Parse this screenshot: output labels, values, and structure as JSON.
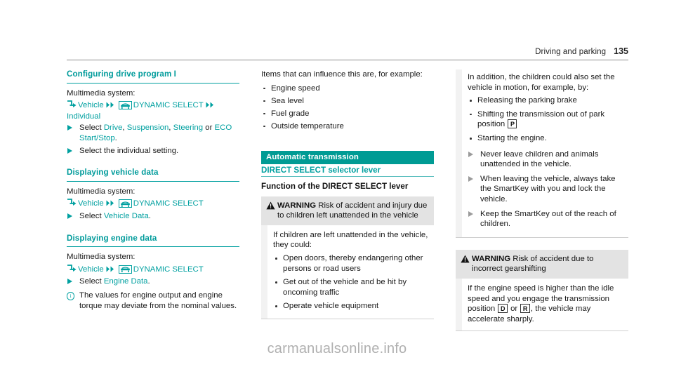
{
  "header": {
    "section_title": "Driving and parking",
    "page_number": "135"
  },
  "watermark": "carmanualsonline.info",
  "colors": {
    "teal": "#009b9b",
    "teal_bar": "#009b94",
    "warning_header_bg": "#e3e3e3",
    "text": "#1a1a1a"
  },
  "icons": {
    "hook_arrow": "hook-arrow-icon",
    "double_arrow": "double-arrow-icon",
    "vehicle_glyph": "vehicle-icon",
    "warning_triangle": "warning-triangle-icon",
    "info_circle": "info-circle-icon",
    "action_triangle": "action-arrow-icon"
  },
  "column1": {
    "sections": [
      {
        "heading": "Configuring drive program I",
        "intro": "Multimedia system:",
        "path": {
          "item1": "Vehicle",
          "item2": "DYNAMIC SELECT",
          "item3": "Individual"
        },
        "actions": [
          {
            "text_before": "Select ",
            "link1": "Drive",
            "sep1": ", ",
            "link2": "Suspension",
            "sep2": ", ",
            "link3": "Steering",
            "sep3": " or ",
            "link4": "ECO Start/Stop",
            "text_after": "."
          },
          {
            "plain": "Select the individual setting."
          }
        ]
      },
      {
        "heading": "Displaying vehicle data",
        "intro": "Multimedia system:",
        "path": {
          "item1": "Vehicle",
          "item2": "DYNAMIC SELECT"
        },
        "actions": [
          {
            "text_before": "Select ",
            "link1": "Vehicle Data",
            "text_after": "."
          }
        ]
      },
      {
        "heading": "Displaying engine data",
        "intro": "Multimedia system:",
        "path": {
          "item1": "Vehicle",
          "item2": "DYNAMIC SELECT"
        },
        "actions": [
          {
            "text_before": "Select ",
            "link1": "Engine Data",
            "text_after": "."
          }
        ],
        "info_note": "The values for engine output and engine torque may deviate from the nominal values."
      }
    ]
  },
  "column2": {
    "intro": "Items that can influence this are, for example:",
    "bullets": [
      "Engine speed",
      "Sea level",
      "Fuel grade",
      "Outside temperature"
    ],
    "bar_heading": "Automatic transmission",
    "sub_heading_teal": "DIRECT SELECT selector lever",
    "sub_heading_black": "Function of the DIRECT SELECT lever",
    "warning": {
      "label": "WARNING",
      "title": " Risk of accident and injury due to children left unattended in the vehicle",
      "body_intro": "If children are left unattended in the vehicle, they could:",
      "bullets": [
        "Open doors, thereby endangering other persons or road users",
        "Get out of the vehicle and be hit by oncoming traffic",
        "Operate vehicle equipment"
      ]
    }
  },
  "column3": {
    "warning_continued": {
      "intro": "In addition, the children could also set the vehicle in motion, for example, by:",
      "bullets": [
        {
          "text": "Releasing the parking brake"
        },
        {
          "text": "Shifting the transmission out of park position ",
          "glyph": "P"
        },
        {
          "text": "Starting the engine."
        }
      ],
      "actions": [
        "Never leave children and animals unattended in the vehicle.",
        "When leaving the vehicle, always take the SmartKey with you and lock the vehicle.",
        "Keep the SmartKey out of the reach of children."
      ]
    },
    "warning2": {
      "label": "WARNING",
      "title": " Risk of accident due to incorrect gearshifting",
      "body_part1": "If the engine speed is higher than the idle speed and you engage the transmission position ",
      "glyph1": "D",
      "body_mid": " or ",
      "glyph2": "R",
      "body_part2": ", the vehicle may accelerate sharply."
    }
  }
}
